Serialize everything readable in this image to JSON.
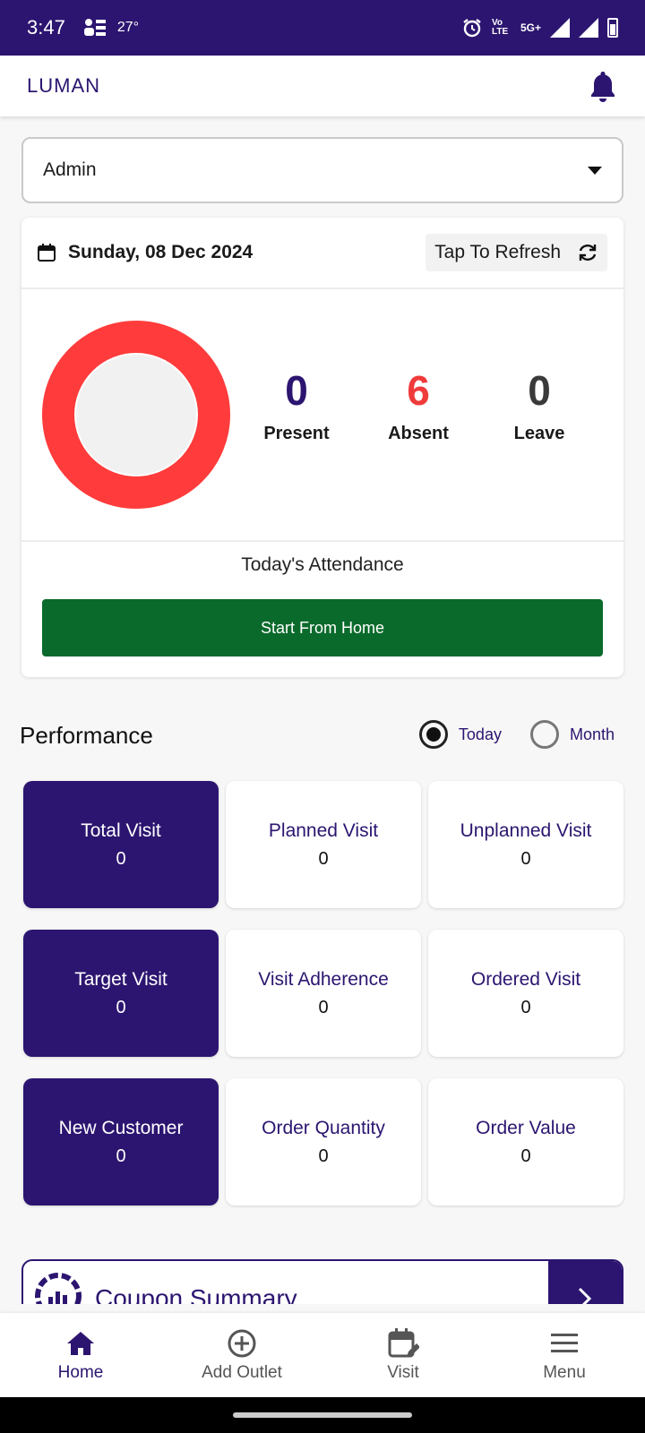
{
  "status_bar": {
    "time": "3:47",
    "temperature": "27°",
    "network": "5G+",
    "volte": "Vo LTE"
  },
  "app_bar": {
    "logo": "LUMAN",
    "bell_icon": "bell-icon"
  },
  "role_select": {
    "value": "Admin"
  },
  "attendance": {
    "date": "Sunday, 08 Dec 2024",
    "refresh_label": "Tap To Refresh",
    "stats": [
      {
        "value": "0",
        "label": "Present",
        "color": "#2c1570"
      },
      {
        "value": "6",
        "label": "Absent",
        "color": "#ef3b3b"
      },
      {
        "value": "0",
        "label": "Leave",
        "color": "#3a3a3a"
      }
    ],
    "footer_label": "Today's Attendance",
    "start_button": "Start From Home",
    "donut_color": "#ff3b3b"
  },
  "performance": {
    "title": "Performance",
    "options": [
      {
        "label": "Today",
        "selected": true
      },
      {
        "label": "Month",
        "selected": false
      }
    ],
    "tiles": [
      {
        "label": "Total Visit",
        "value": "0"
      },
      {
        "label": "Planned Visit",
        "value": "0"
      },
      {
        "label": "Unplanned Visit",
        "value": "0"
      },
      {
        "label": "Target Visit",
        "value": "0"
      },
      {
        "label": "Visit Adherence",
        "value": "0"
      },
      {
        "label": "Ordered Visit",
        "value": "0"
      },
      {
        "label": "New Customer",
        "value": "0"
      },
      {
        "label": "Order Quantity",
        "value": "0"
      },
      {
        "label": "Order Value",
        "value": "0"
      }
    ]
  },
  "coupon": {
    "title": "Coupon Summary"
  },
  "bottom_nav": [
    {
      "label": "Home",
      "icon": "home-icon"
    },
    {
      "label": "Add Outlet",
      "icon": "add-circle-icon"
    },
    {
      "label": "Visit",
      "icon": "calendar-edit-icon"
    },
    {
      "label": "Menu",
      "icon": "menu-icon"
    }
  ],
  "colors": {
    "brand": "#2c1570",
    "start_button": "#0a6a2b"
  }
}
